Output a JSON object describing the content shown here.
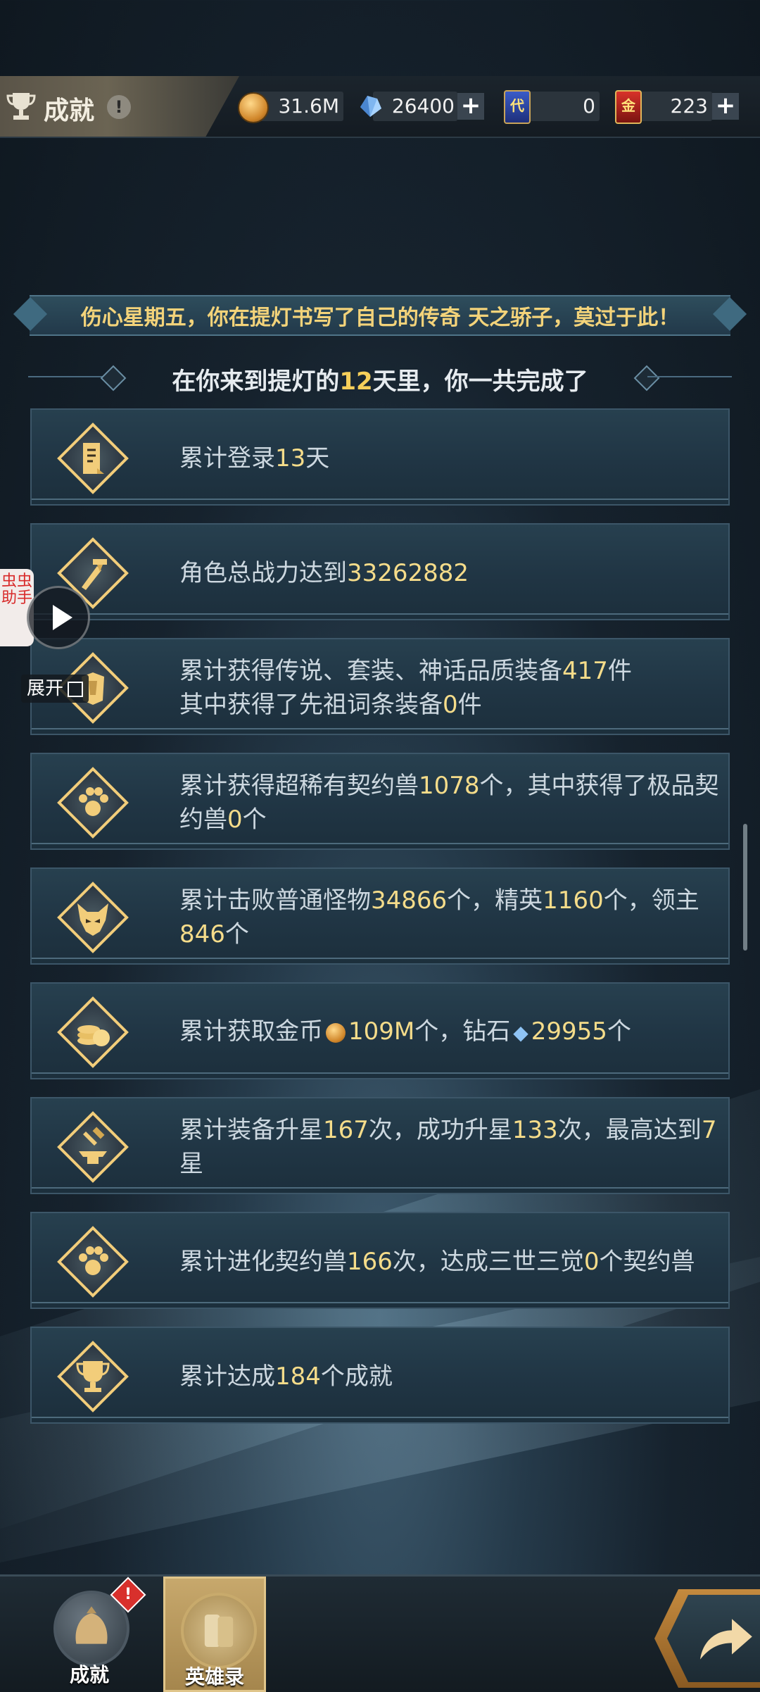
{
  "header": {
    "title": "成就",
    "info_glyph": "!",
    "resources": [
      {
        "icon": "gold-coin-icon",
        "value": "31.6M",
        "has_plus": false
      },
      {
        "icon": "diamond-icon",
        "value": "26400",
        "has_plus": true
      },
      {
        "icon": "voucher-card-icon",
        "card_text": "代",
        "value": "0",
        "has_plus": false
      },
      {
        "icon": "gold-card-icon",
        "card_text": "金",
        "value": "223",
        "has_plus": true
      }
    ],
    "plus_glyph": "+"
  },
  "banner": {
    "text": "伤心星期五，你在提灯书写了自己的传奇 天之骄子，莫过于此！"
  },
  "summary": {
    "prefix": "在你来到提灯的",
    "days": "12",
    "suffix": "天里，你一共完成了"
  },
  "achievements": [
    {
      "icon": "login-scroll-icon",
      "parts": [
        [
          "累计登录",
          0
        ],
        [
          "13",
          1
        ],
        [
          "天",
          0
        ]
      ]
    },
    {
      "icon": "sword-power-icon",
      "parts": [
        [
          "角色总战力达到",
          0
        ],
        [
          "33262882",
          1
        ]
      ]
    },
    {
      "icon": "armor-gear-icon",
      "parts": [
        [
          "累计获得传说、套装、神话品质装备",
          0
        ],
        [
          "417",
          1
        ],
        [
          "件",
          0
        ]
      ],
      "line2": [
        [
          "其中获得了先祖词条装备",
          0
        ],
        [
          "0",
          1
        ],
        [
          "件",
          0
        ]
      ]
    },
    {
      "icon": "paw-beast-icon",
      "parts": [
        [
          "累计获得超稀有契约兽",
          0
        ],
        [
          "1078",
          1
        ],
        [
          "个，其中获得了极品契约兽",
          0
        ],
        [
          "0",
          1
        ],
        [
          "个",
          0
        ]
      ]
    },
    {
      "icon": "demon-mask-icon",
      "parts": [
        [
          "累计击败普通怪物",
          0
        ],
        [
          "34866",
          1
        ],
        [
          "个，精英",
          0
        ],
        [
          "1160",
          1
        ],
        [
          "个，领主",
          0
        ],
        [
          "846",
          1
        ],
        [
          "个",
          0
        ]
      ]
    },
    {
      "icon": "coin-stack-icon",
      "parts": [
        [
          "累计获取金币",
          0
        ],
        [
          "●",
          2
        ],
        [
          "109M",
          1
        ],
        [
          "个，钻石",
          0
        ],
        [
          "◆",
          3
        ],
        [
          "29955",
          1
        ],
        [
          "个",
          0
        ]
      ]
    },
    {
      "icon": "anvil-hammer-icon",
      "parts": [
        [
          "累计装备升星",
          0
        ],
        [
          "167",
          1
        ],
        [
          "次，成功升星",
          0
        ],
        [
          "133",
          1
        ],
        [
          "次，最高达到",
          0
        ],
        [
          "7",
          1
        ],
        [
          "星",
          0
        ]
      ]
    },
    {
      "icon": "paw-evolve-icon",
      "parts": [
        [
          "累计进化契约兽",
          0
        ],
        [
          "166",
          1
        ],
        [
          "次，达成三世三觉",
          0
        ],
        [
          "0",
          1
        ],
        [
          "个契约兽",
          0
        ]
      ]
    },
    {
      "icon": "trophy-icon",
      "parts": [
        [
          "累计达成",
          0
        ],
        [
          "184",
          1
        ],
        [
          "个成就",
          0
        ]
      ]
    }
  ],
  "helper": {
    "tab_text": "虫虫助手",
    "expand_label": "展开"
  },
  "bottom_tabs": [
    {
      "label": "成就",
      "icon": "achievement-bag-icon",
      "badge": "!",
      "active": false
    },
    {
      "label": "英雄录",
      "icon": "hero-scroll-icon",
      "active": true
    }
  ],
  "colors": {
    "highlight": "#f5dc8a",
    "banner_text": "#f3d37a",
    "emblem_gold": "#f2cd7a",
    "row_bg": "#203544"
  }
}
